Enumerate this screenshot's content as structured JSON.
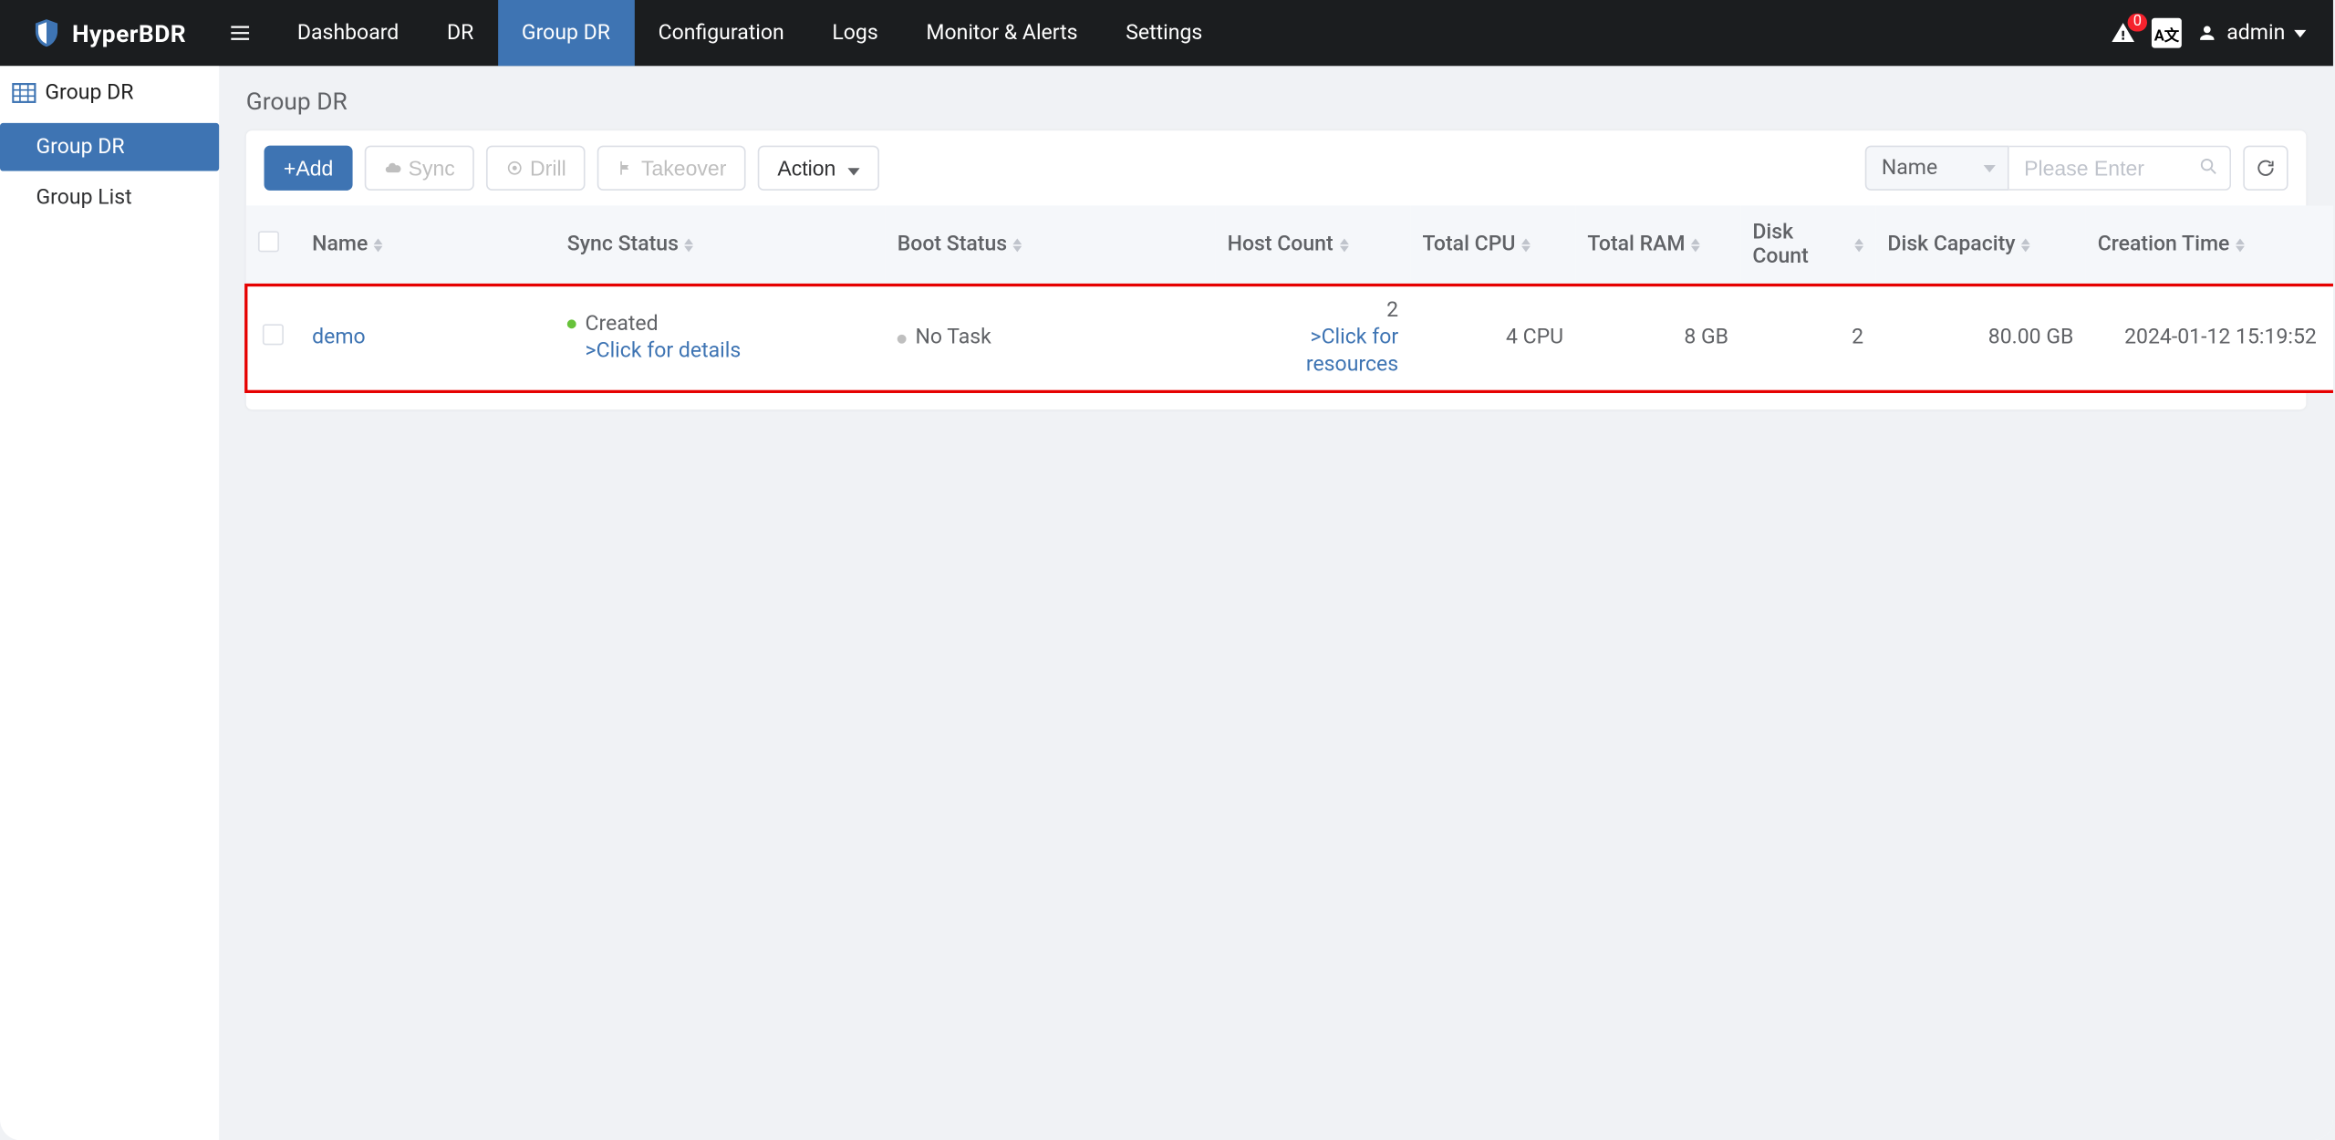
{
  "brand": {
    "name": "HyperBDR"
  },
  "topnav": {
    "items": [
      {
        "label": "Dashboard"
      },
      {
        "label": "DR"
      },
      {
        "label": "Group DR"
      },
      {
        "label": "Configuration"
      },
      {
        "label": "Logs"
      },
      {
        "label": "Monitor & Alerts"
      },
      {
        "label": "Settings"
      }
    ],
    "activeIndex": 2
  },
  "topbarRight": {
    "alertCount": "0",
    "langBadge": "A文",
    "username": "admin"
  },
  "sidebar": {
    "sectionTitle": "Group DR",
    "items": [
      {
        "label": "Group DR",
        "active": true
      },
      {
        "label": "Group List",
        "active": false
      }
    ]
  },
  "page": {
    "title": "Group DR"
  },
  "toolbar": {
    "add": "+Add",
    "sync": "Sync",
    "drill": "Drill",
    "takeover": "Takeover",
    "action": "Action",
    "searchField": "Name",
    "searchPlaceholder": "Please Enter"
  },
  "table": {
    "columns": {
      "name": "Name",
      "syncStatus": "Sync Status",
      "bootStatus": "Boot Status",
      "hostCount": "Host Count",
      "totalCpu": "Total CPU",
      "totalRam": "Total RAM",
      "diskCount": "Disk Count",
      "diskCapacity": "Disk Capacity",
      "creationTime": "Creation Time"
    },
    "rows": [
      {
        "name": "demo",
        "syncStatus": "Created",
        "syncDetail": ">Click for details",
        "bootStatus": "No Task",
        "hostCount": "2",
        "hostDetail": ">Click for resources",
        "totalCpu": "4 CPU",
        "totalRam": "8 GB",
        "diskCount": "2",
        "diskCapacity": "80.00 GB",
        "creationTime": "2024-01-12 15:19:52"
      }
    ]
  }
}
